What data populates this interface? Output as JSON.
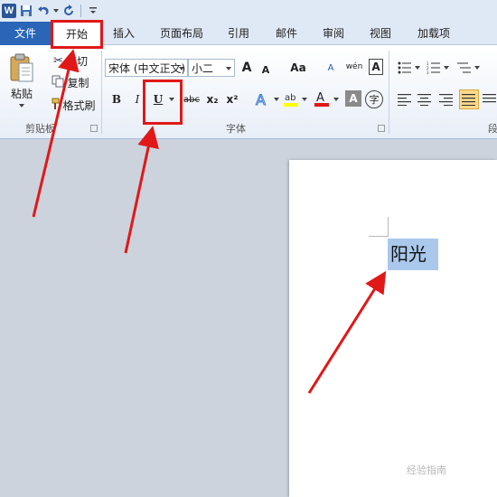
{
  "quick_access": {
    "word_logo": "W",
    "icons": [
      "word-logo",
      "save-icon",
      "undo-icon",
      "redo-icon",
      "customize-icon"
    ]
  },
  "tabs": [
    {
      "label": "文件"
    },
    {
      "label": "开始"
    },
    {
      "label": "插入"
    },
    {
      "label": "页面布局"
    },
    {
      "label": "引用"
    },
    {
      "label": "邮件"
    },
    {
      "label": "审阅"
    },
    {
      "label": "视图"
    },
    {
      "label": "加载项"
    }
  ],
  "clipboard": {
    "paste_label": "粘贴",
    "cut_label": "剪切",
    "copy_label": "复制",
    "format_painter_label": "格式刷",
    "group_label": "剪贴板"
  },
  "font": {
    "font_name": "宋体 (中文正文)",
    "font_size": "小二",
    "grow_label": "A",
    "shrink_label": "A",
    "case_label": "Aa",
    "clear_label": "A",
    "bold": "B",
    "italic": "I",
    "underline": "U",
    "strikethrough": "abc",
    "subscript": "x₂",
    "superscript": "x²",
    "font_color_label": "A",
    "char_shading_label": "A",
    "enclose_label": "字",
    "phonetic_label": "wén",
    "group_label": "字体"
  },
  "paragraph": {
    "group_label": "段"
  },
  "document": {
    "selected_text": "阳光"
  },
  "watermark": "经验指南",
  "colors": {
    "highlight": "#e01818",
    "selection": "#a9c8ec",
    "file_tab": "#2a65b8",
    "font_color_bar": "#e01818",
    "highlighter_bar": "#ffff00"
  }
}
